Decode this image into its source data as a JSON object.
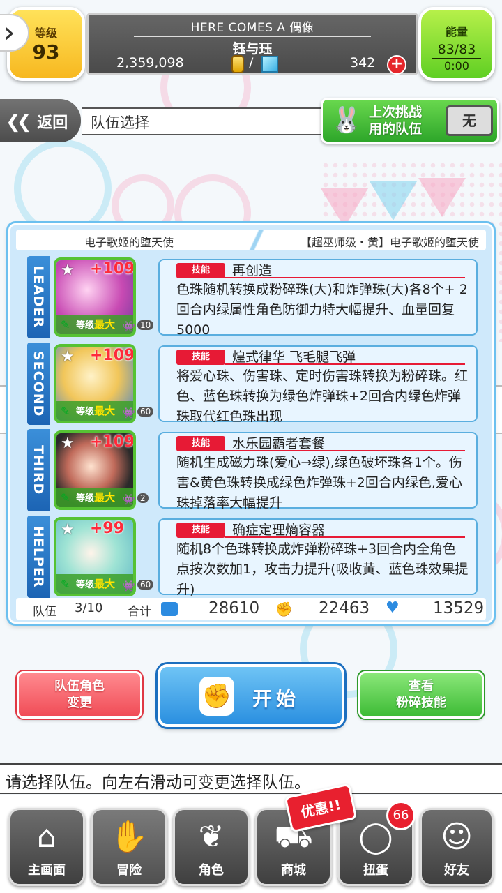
{
  "header": {
    "level_label": "等级",
    "level_value": "93",
    "event_title": "HERE COMES A 偶像",
    "player_name": "钰与珏",
    "coins": "2,359,098",
    "gems": "342",
    "energy_label": "能量",
    "energy_value": "83/83",
    "energy_timer": "0:00"
  },
  "nav": {
    "back_label": "返回",
    "page_title": "队伍选择",
    "last_team_line1": "上次挑战",
    "last_team_line2": "用的队伍",
    "last_team_value": "无"
  },
  "team": {
    "name_left": "电子歌姬的堕天使",
    "name_right": "【超巫师级・黄】电子歌姬的堕天使",
    "members": [
      {
        "slot": "LEADER",
        "plus": "+109",
        "level_label": "等级",
        "level_value": "最大",
        "count": "10",
        "skill_tag": "技能",
        "skill_name": "再创造",
        "skill_desc": "色珠随机转换成粉碎珠(大)和炸弹珠(大)各8个+ 2回合内绿属性角色防御力特大幅提升、血量回复5000"
      },
      {
        "slot": "SECOND",
        "plus": "+109",
        "level_label": "等级",
        "level_value": "最大",
        "count": "60",
        "skill_tag": "技能",
        "skill_name": "煌式律华 飞毛腿飞弹",
        "skill_desc": "将爱心珠、伤害珠、定时伤害珠转换为粉碎珠。红色、蓝色珠转换为绿色炸弹珠+2回合内绿色炸弹珠取代红色珠出现"
      },
      {
        "slot": "THIRD",
        "plus": "+109",
        "level_label": "等级",
        "level_value": "最大",
        "count": "2",
        "skill_tag": "技能",
        "skill_name": "水乐园霸者套餐",
        "skill_desc": "随机生成磁力珠(爱心→绿),绿色破坏珠各1个。伤害&黄色珠转换成绿色炸弹珠+2回合内绿色,爱心珠掉落率大幅提升"
      },
      {
        "slot": "HELPER",
        "plus": "+99",
        "level_label": "等级",
        "level_value": "最大",
        "count": "60",
        "skill_tag": "技能",
        "skill_name": "确症定理熵容器",
        "skill_desc": "随机8个色珠转换成炸弹粉碎珠+3回合内全角色点按次数加1，攻击力提升(吸收黄、蓝色珠效果提升)"
      }
    ],
    "totals": {
      "team_label": "队伍",
      "team_count": "3/10",
      "sum_label": "合计",
      "hp": "28610",
      "attack": "22463",
      "heal": "13529"
    }
  },
  "actions": {
    "change_line1": "队伍角色",
    "change_line2": "变更",
    "start_label": "开始",
    "view_line1": "查看",
    "view_line2": "粉碎技能"
  },
  "message": "请选择队伍。向左右滑动可变更选择队伍。",
  "bottom_nav": {
    "home": "主画面",
    "adventure": "冒险",
    "characters": "角色",
    "shop": "商城",
    "gacha": "扭蛋",
    "friends": "好友",
    "sale_badge": "优惠!!",
    "gacha_count": "66"
  },
  "colors": {
    "leader_tab": "#1c64b4",
    "skill_tag": "#e71a35",
    "start_button": "#2a8fe0",
    "energy": "#5fcf23",
    "level": "#f7b820"
  }
}
